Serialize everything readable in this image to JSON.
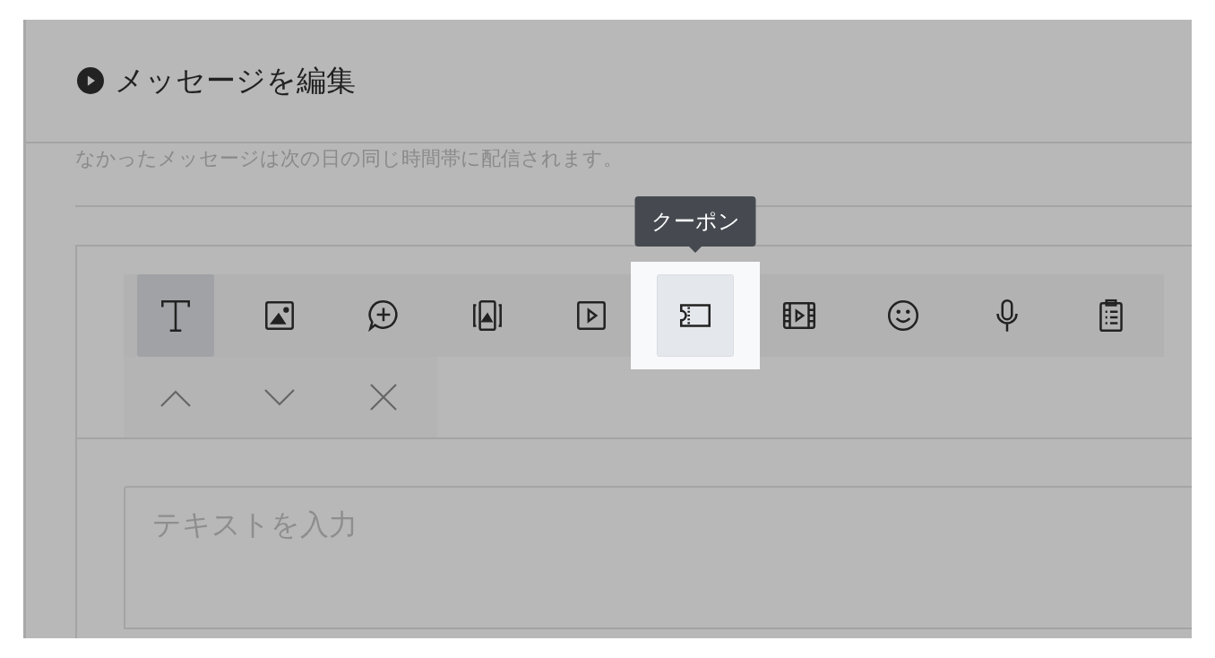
{
  "header": {
    "title": "メッセージを編集"
  },
  "notice": "なかったメッセージは次の日の同じ時間帯に配信されます。",
  "tools": [
    {
      "kind": "text",
      "selected": true,
      "spotlight": false
    },
    {
      "kind": "image",
      "selected": false,
      "spotlight": false
    },
    {
      "kind": "bubble",
      "selected": false,
      "spotlight": false
    },
    {
      "kind": "carousel",
      "selected": false,
      "spotlight": false
    },
    {
      "kind": "video",
      "selected": false,
      "spotlight": false
    },
    {
      "kind": "coupon",
      "selected": false,
      "spotlight": true,
      "tooltip": "クーポン"
    },
    {
      "kind": "film",
      "selected": false,
      "spotlight": false
    },
    {
      "kind": "smile",
      "selected": false,
      "spotlight": false
    },
    {
      "kind": "mic",
      "selected": false,
      "spotlight": false
    },
    {
      "kind": "clipboard",
      "selected": false,
      "spotlight": false
    }
  ],
  "actions": [
    {
      "kind": "up"
    },
    {
      "kind": "down"
    },
    {
      "kind": "close"
    }
  ],
  "editor": {
    "placeholder": "テキストを入力"
  }
}
